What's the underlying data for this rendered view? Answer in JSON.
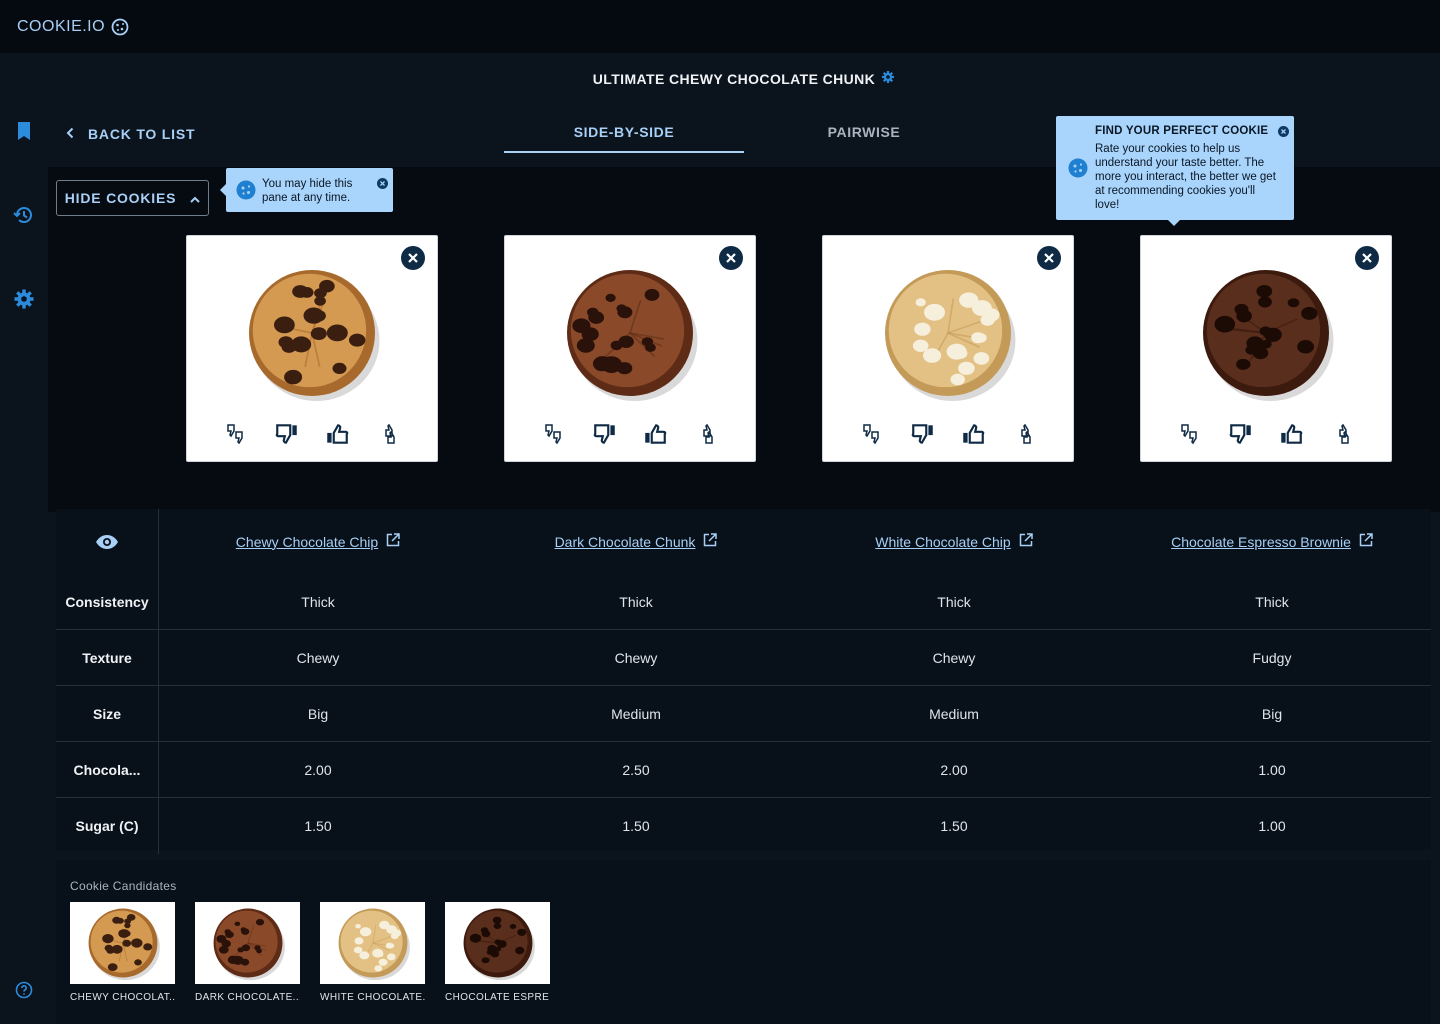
{
  "app": {
    "logo_text": "COOKIE.IO"
  },
  "sidebar": {
    "items": [
      "bookmark-icon",
      "history-icon",
      "settings-icon",
      "help-icon"
    ]
  },
  "page": {
    "title": "ULTIMATE CHEWY CHOCOLATE CHUNK"
  },
  "nav": {
    "back_label": "BACK TO LIST"
  },
  "tabs": [
    {
      "label": "SIDE-BY-SIDE",
      "active": true
    },
    {
      "label": "PAIRWISE",
      "active": false
    }
  ],
  "hide_button": {
    "label": "HIDE COOKIES"
  },
  "tooltips": {
    "hide_hint": "You may hide this pane at any time.",
    "perfect_title": "FIND YOUR PERFECT COOKIE",
    "perfect_body": "Rate your cookies to help us understand your taste better. The more you interact, the better we get at recommending cookies you'll love!"
  },
  "cookies": [
    {
      "name": "Chewy Chocolate Chip",
      "short": "CHEWY CHOCOLAT...",
      "dough": "#d49a52",
      "edge": "#a86a2c",
      "chips": "#3a1e10"
    },
    {
      "name": "Dark Chocolate Chunk",
      "short": "DARK CHOCOLATE...",
      "dough": "#8a4a2a",
      "edge": "#5e2c16",
      "chips": "#2a120a"
    },
    {
      "name": "White Chocolate Chip",
      "short": "WHITE CHOCOLATE...",
      "dough": "#e3c184",
      "edge": "#c49a58",
      "chips": "#f6efdc"
    },
    {
      "name": "Chocolate Espresso Brownie",
      "short": "CHOCOLATE ESPRE...",
      "dough": "#5a2e1c",
      "edge": "#3c1a0e",
      "chips": "#1c0a04"
    }
  ],
  "table": {
    "rows": [
      {
        "label": "Consistency",
        "values": [
          "Thick",
          "Thick",
          "Thick",
          "Thick"
        ]
      },
      {
        "label": "Texture",
        "values": [
          "Chewy",
          "Chewy",
          "Chewy",
          "Fudgy"
        ]
      },
      {
        "label": "Size",
        "values": [
          "Big",
          "Medium",
          "Medium",
          "Big"
        ]
      },
      {
        "label": "Chocola...",
        "values": [
          "2.00",
          "2.50",
          "2.00",
          "1.00"
        ]
      },
      {
        "label": "Sugar (C)",
        "values": [
          "1.50",
          "1.50",
          "1.50",
          "1.00"
        ]
      }
    ]
  },
  "candidates": {
    "title": "Cookie Candidates"
  },
  "colors": {
    "accent": "#a8cff5",
    "tooltip_bg": "#a9d4fb",
    "icon_dark": "#0e2a44",
    "icon_blue": "#1f7fd0"
  }
}
